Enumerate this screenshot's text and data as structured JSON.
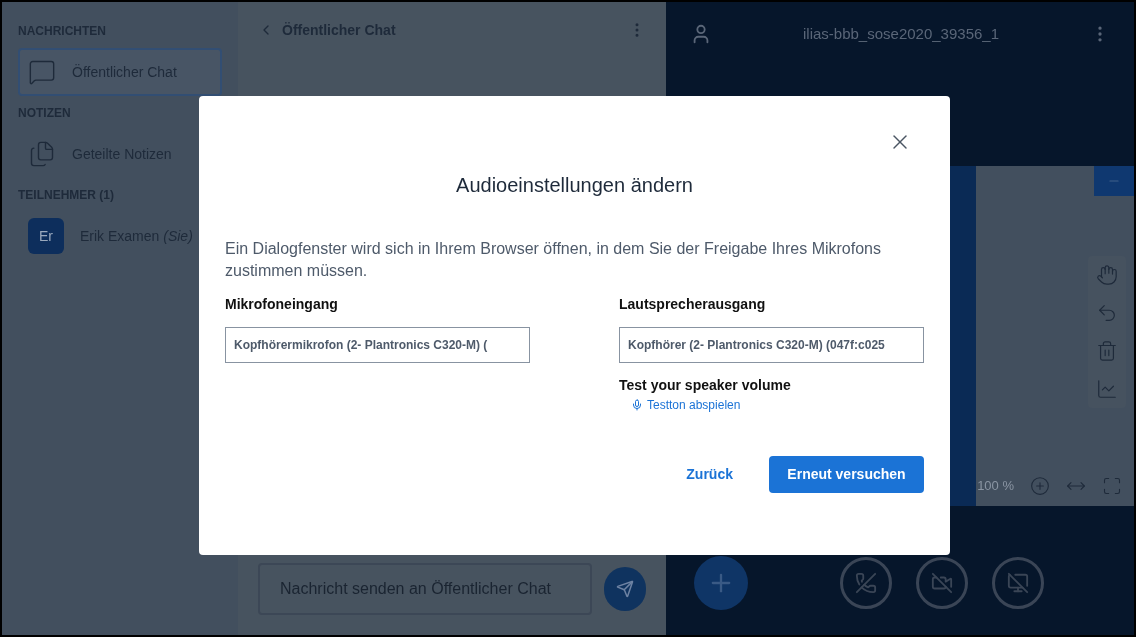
{
  "sidebar": {
    "sections": [
      {
        "title": "NACHRICHTEN",
        "items": [
          {
            "kind": "chat",
            "label": "Öffentlicher Chat",
            "selected": true
          }
        ]
      },
      {
        "title": "NOTIZEN",
        "items": [
          {
            "kind": "notes",
            "label": "Geteilte Notizen",
            "selected": false
          }
        ]
      },
      {
        "title": "TEILNEHMER (1)",
        "items": [
          {
            "kind": "user",
            "label": "Erik Examen",
            "suffix": "(Sie)",
            "avatar": "Er",
            "selected": false
          }
        ]
      }
    ]
  },
  "chat": {
    "title": "Öffentlicher Chat",
    "placeholder": "Nachricht senden an Öffentlicher Chat"
  },
  "meeting": {
    "title": "ilias-bbb_sose2020_39356_1",
    "zoom": "100 %"
  },
  "dialog": {
    "title": "Audioeinstellungen ändern",
    "message": "Ein Dialogfenster wird sich in Ihrem Browser öffnen, in dem Sie der Freigabe Ihres Mikrofons zustimmen müssen.",
    "microphone": {
      "label": "Mikrofoneingang",
      "value": "Kopfhörermikrofon (2- Plantronics C320-M) ("
    },
    "speaker": {
      "label": "Lautsprecherausgang",
      "value": "Kopfhörer (2- Plantronics C320-M) (047f:c025"
    },
    "test_label": "Test your speaker volume",
    "test_link": "Testton abspielen",
    "buttons": [
      {
        "kind": "link",
        "label": "Zurück"
      },
      {
        "kind": "primary",
        "label": "Erneut versuchen"
      }
    ]
  }
}
